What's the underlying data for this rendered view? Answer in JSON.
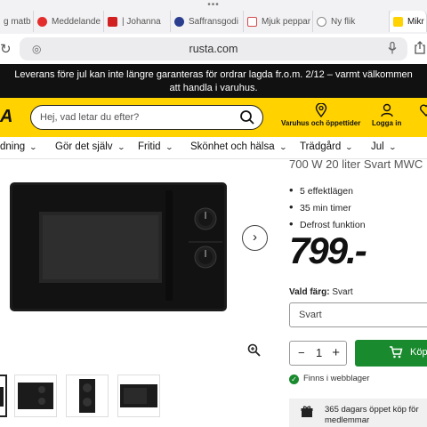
{
  "browser": {
    "tabs": [
      {
        "label": "g matb",
        "color": "#e55b3c"
      },
      {
        "label": "Meddelande",
        "color": "#e32d2d"
      },
      {
        "label": "| Johanna",
        "color": "#d12020"
      },
      {
        "label": "Saffransgodi",
        "color": "#2b3d8f"
      },
      {
        "label": "Mjuk peppar",
        "color": "#d44c4c"
      },
      {
        "label": "Ny flik",
        "color": "#8a8a8a"
      },
      {
        "label": "Mikr",
        "color": "#ffd200"
      }
    ],
    "url": "rusta.com"
  },
  "announcement": {
    "line1": "Leverans före jul kan inte längre garanteras för ordrar lagda fr.o.m. 2/12 – varmt välkommen",
    "line2": "att handla i varuhus."
  },
  "header": {
    "logo_fragment": "A",
    "search_placeholder": "Hej, vad letar du efter?",
    "stores_label": "Varuhus och öppettider",
    "login_label": "Logga in"
  },
  "nav": {
    "items": [
      "dning",
      "Gör det själv",
      "Fritid",
      "Skönhet och hälsa",
      "Trädgård",
      "Jul"
    ]
  },
  "product": {
    "title_fragment": "700 W 20 liter Svart MWC",
    "features": [
      "5 effektlägen",
      "35 min timer",
      "Defrost funktion"
    ],
    "price": "799.-",
    "color_label": "Vald färg:",
    "color_value": "Svart",
    "color_select_value": "Svart",
    "quantity": "1",
    "minus": "−",
    "plus": "+",
    "buy_label": "Köp",
    "stock_text": "Finns i webblager",
    "member_line1": "365 dagars öppet köp för",
    "member_line2": "medlemmar"
  },
  "colors": {
    "brand_yellow": "#ffd200",
    "buy_green": "#1a8a2e",
    "announce_bg": "#111111"
  }
}
